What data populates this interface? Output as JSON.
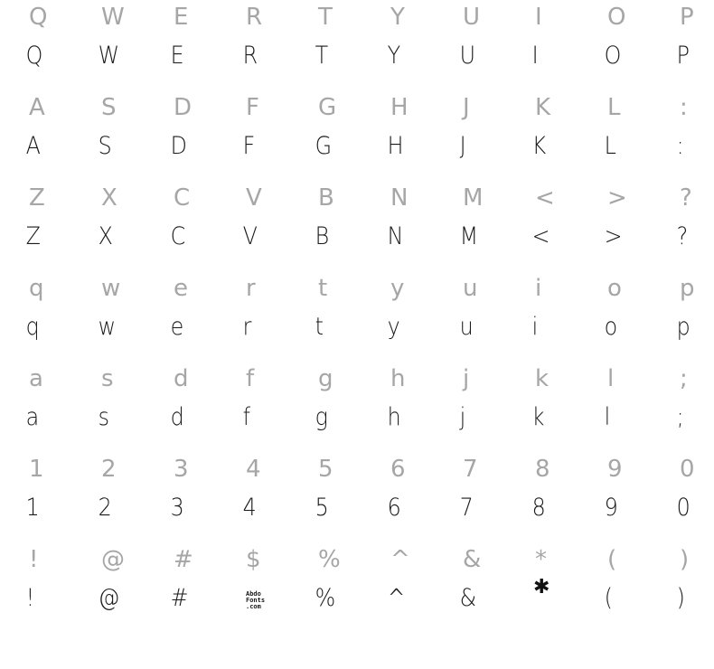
{
  "rows": [
    {
      "ref": [
        "Q",
        "W",
        "E",
        "R",
        "T",
        "Y",
        "U",
        "I",
        "O",
        "P"
      ],
      "sample": [
        "Q",
        "W",
        "E",
        "R",
        "T",
        "Y",
        "U",
        "I",
        "O",
        "P"
      ]
    },
    {
      "ref": [
        "A",
        "S",
        "D",
        "F",
        "G",
        "H",
        "J",
        "K",
        "L",
        ":"
      ],
      "sample": [
        "A",
        "S",
        "D",
        "F",
        "G",
        "H",
        "J",
        "K",
        "L",
        ":"
      ]
    },
    {
      "ref": [
        "Z",
        "X",
        "C",
        "V",
        "B",
        "N",
        "M",
        "<",
        ">",
        "?"
      ],
      "sample": [
        "Z",
        "X",
        "C",
        "V",
        "B",
        "N",
        "M",
        "<",
        ">",
        "?"
      ]
    },
    {
      "ref": [
        "q",
        "w",
        "e",
        "r",
        "t",
        "y",
        "u",
        "i",
        "o",
        "p"
      ],
      "sample": [
        "q",
        "w",
        "e",
        "r",
        "t",
        "y",
        "u",
        "i",
        "o",
        "p"
      ]
    },
    {
      "ref": [
        "a",
        "s",
        "d",
        "f",
        "g",
        "h",
        "j",
        "k",
        "l",
        ";"
      ],
      "sample": [
        "a",
        "s",
        "d",
        "f",
        "g",
        "h",
        "j",
        "k",
        "l",
        ";"
      ]
    },
    {
      "ref": [
        "1",
        "2",
        "3",
        "4",
        "5",
        "6",
        "7",
        "8",
        "9",
        "0"
      ],
      "sample": [
        "1",
        "2",
        "3",
        "4",
        "5",
        "6",
        "7",
        "8",
        "9",
        "0"
      ]
    },
    {
      "ref": [
        "!",
        "@",
        "#",
        "$",
        "%",
        "^",
        "&",
        "*",
        "(",
        ")"
      ],
      "sample": [
        "!",
        "@",
        "#",
        "",
        "%",
        "^",
        "&",
        "",
        "(",
        ")"
      ]
    }
  ],
  "logo": {
    "line1": "Abdo",
    "line2": "Fonts",
    "line3": ".com"
  },
  "star_glyph": "✱"
}
